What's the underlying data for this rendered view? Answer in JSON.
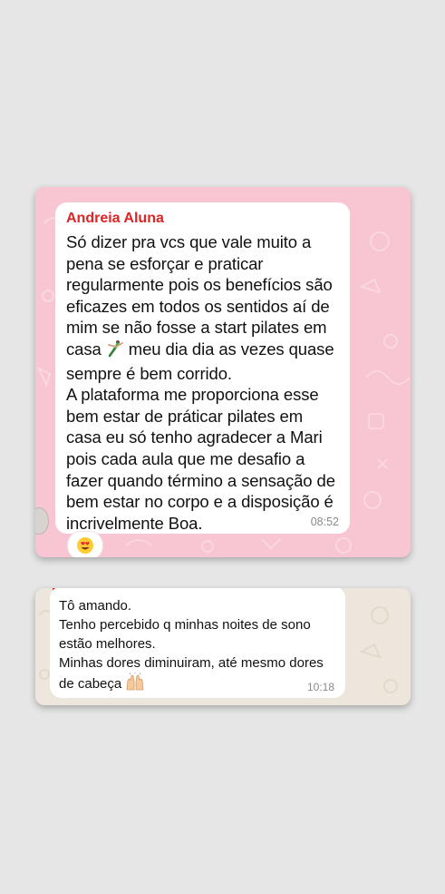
{
  "screenshot_1": {
    "sender": "Andreia Aluna",
    "paragraph_1_before_emoji": "Só dizer pra vcs que vale muito a pena se esforçar e praticar regularmente pois os benefícios são eficazes em todos os sentidos aí de mim se não fosse a start pilates em casa",
    "paragraph_1_after_emoji": "meu dia dia as vezes quase sempre é bem corrido.",
    "paragraph_2": "A plataforma me proporciona esse bem estar de práticar pilates em casa eu só tenho agradecer a Mari pois cada aula que me desafio a fazer quando término a sensação de bem estar no corpo e a disposição é incrivelmente Boa.",
    "time": "08:52",
    "inline_icon": "pilates-figure-icon",
    "reaction_icon": "heart-eyes-emoji-icon"
  },
  "screenshot_2": {
    "line_1": "Tô amando.",
    "line_2": "Tenho percebido q minhas noites de sono estão melhores.",
    "line_3_before_emoji": "Minhas dores diminuiram, até mesmo dores de cabeça",
    "time": "10:18",
    "inline_icon": "raised-hands-emoji-icon"
  },
  "colors": {
    "page_background": "#e6e6e6",
    "pink_wallpaper": "#f7c6d2",
    "beige_wallpaper": "#ede6dc",
    "sender_name": "#e02424",
    "bubble": "#ffffff",
    "timestamp": "#8a8a8a"
  }
}
